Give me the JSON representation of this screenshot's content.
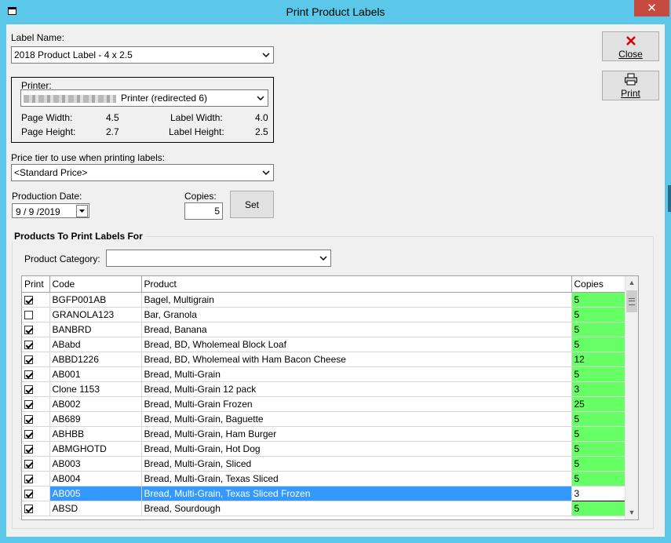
{
  "window": {
    "title": "Print Product Labels"
  },
  "label_name": {
    "label": "Label Name:",
    "value": "2018 Product Label - 4 x 2.5"
  },
  "printer": {
    "label": "Printer:",
    "value": "Printer (redirected 6)",
    "page_width_label": "Page Width:",
    "page_width": "4.5",
    "page_height_label": "Page Height:",
    "page_height": "2.7",
    "label_width_label": "Label Width:",
    "label_width": "4.0",
    "label_height_label": "Label Height:",
    "label_height": "2.5"
  },
  "price_tier": {
    "label": "Price tier to use when printing labels:",
    "value": "<Standard Price>"
  },
  "production_date": {
    "label": "Production Date:",
    "value": "9 / 9 /2019"
  },
  "copies": {
    "label": "Copies:",
    "value": "5"
  },
  "buttons": {
    "set": "Set",
    "close": "Close",
    "print": "Print"
  },
  "products": {
    "group_title": "Products To Print Labels For",
    "category_label": "Product Category:",
    "category_value": "",
    "columns": {
      "print": "Print",
      "code": "Code",
      "product": "Product",
      "copies": "Copies"
    },
    "rows": [
      {
        "print": true,
        "code": "BGFP001AB",
        "product": "Bagel, Multigrain",
        "copies": "5"
      },
      {
        "print": false,
        "code": "GRANOLA123",
        "product": "Bar, Granola",
        "copies": "5"
      },
      {
        "print": true,
        "code": "BANBRD",
        "product": "Bread, Banana",
        "copies": "5"
      },
      {
        "print": true,
        "code": "ABabd",
        "product": "Bread, BD, Wholemeal Block Loaf",
        "copies": "5"
      },
      {
        "print": true,
        "code": "ABBD1226",
        "product": "Bread, BD, Wholemeal with Ham Bacon Cheese",
        "copies": "12"
      },
      {
        "print": true,
        "code": "AB001",
        "product": "Bread, Multi-Grain",
        "copies": "5"
      },
      {
        "print": true,
        "code": "Clone 1153",
        "product": "Bread, Multi-Grain 12 pack",
        "copies": "3"
      },
      {
        "print": true,
        "code": "AB002",
        "product": "Bread, Multi-Grain Frozen",
        "copies": "25"
      },
      {
        "print": true,
        "code": "AB689",
        "product": "Bread, Multi-Grain, Baguette",
        "copies": "5"
      },
      {
        "print": true,
        "code": "ABHBB",
        "product": "Bread, Multi-Grain, Ham Burger",
        "copies": "5"
      },
      {
        "print": true,
        "code": "ABMGHOTD",
        "product": "Bread, Multi-Grain, Hot Dog",
        "copies": "5"
      },
      {
        "print": true,
        "code": "AB003",
        "product": "Bread, Multi-Grain, Sliced",
        "copies": "5"
      },
      {
        "print": true,
        "code": "AB004",
        "product": "Bread, Multi-Grain, Texas Sliced",
        "copies": "5"
      },
      {
        "print": true,
        "code": "AB005",
        "product": "Bread, Multi-Grain, Texas Sliced Frozen",
        "copies": "3",
        "selected": true
      },
      {
        "print": true,
        "code": "ABSD",
        "product": "Bread, Sourdough",
        "copies": "5"
      }
    ]
  },
  "colors": {
    "title_bar": "#5bc7e9",
    "close_button": "#c74a41",
    "copies_cell": "#66ff66",
    "selection": "#3399ff"
  }
}
